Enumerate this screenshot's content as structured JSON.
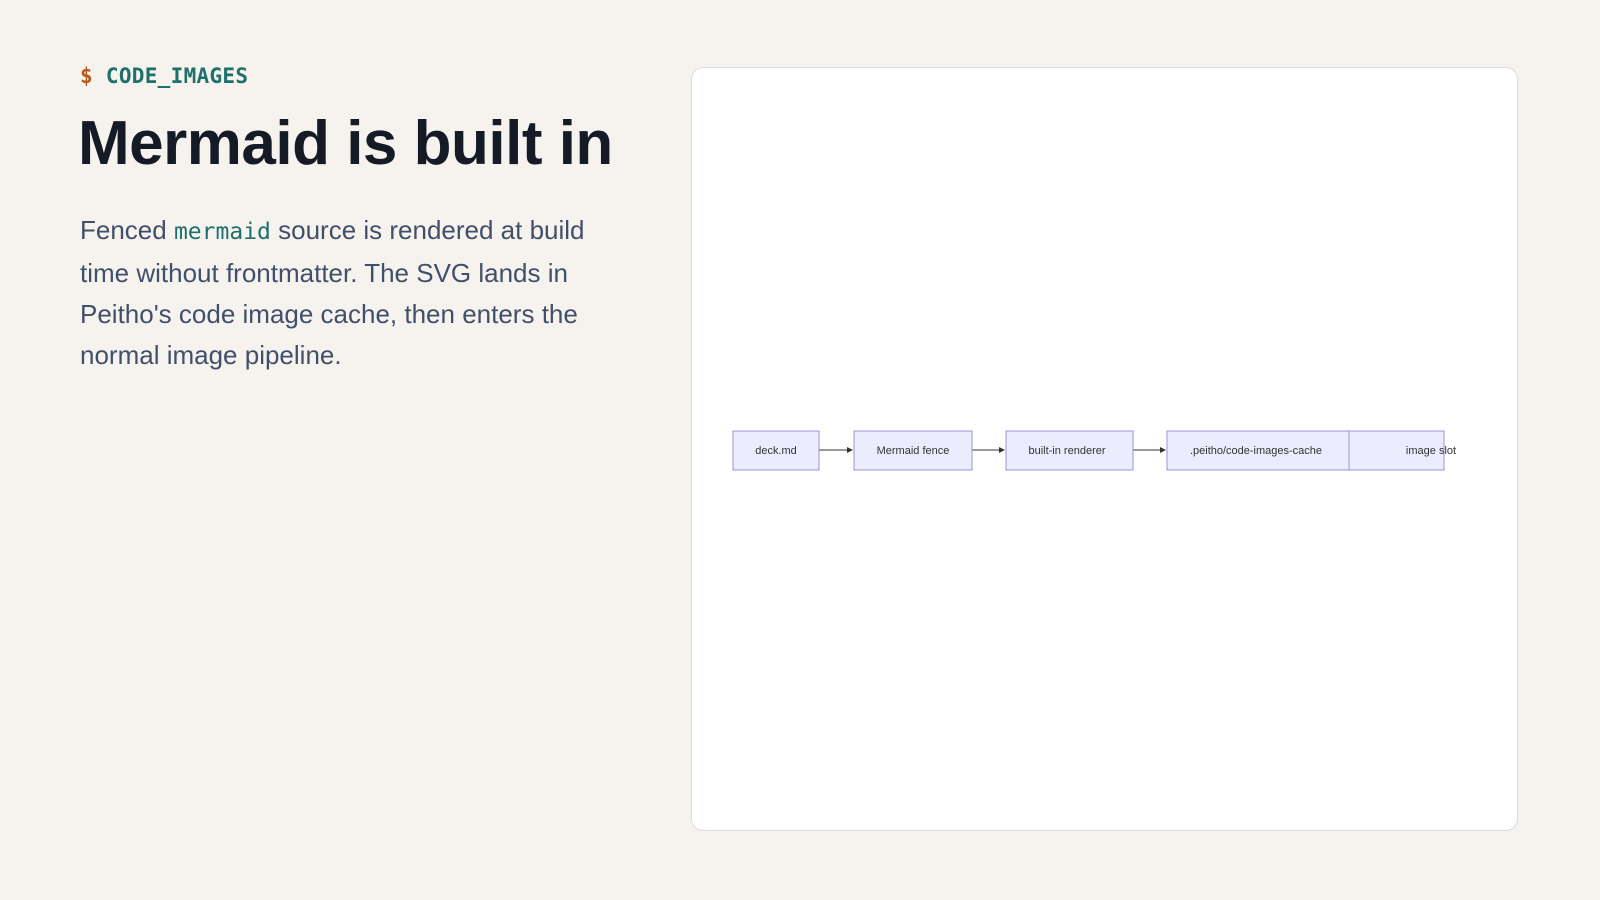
{
  "kicker": {
    "prompt": "$",
    "label": "CODE_IMAGES"
  },
  "title": "Mermaid is built in",
  "body": {
    "before": "Fenced ",
    "code": "mermaid",
    "after": " source is rendered at build time without frontmatter. The SVG lands in Peitho's code image cache, then enters the normal image pipeline."
  },
  "diagram": {
    "direction": "left-to-right",
    "nodes": [
      {
        "id": "n1",
        "label": "deck.md"
      },
      {
        "id": "n2",
        "label": "Mermaid fence"
      },
      {
        "id": "n3",
        "label": "built-in renderer"
      },
      {
        "id": "n4",
        "label": ".peitho/code-images-cache"
      },
      {
        "id": "n5",
        "label": "image slot"
      }
    ],
    "edges": [
      {
        "from": "n1",
        "to": "n2"
      },
      {
        "from": "n2",
        "to": "n3"
      },
      {
        "from": "n3",
        "to": "n4"
      },
      {
        "from": "n4",
        "to": "n5"
      }
    ],
    "colors": {
      "node_fill": "#ececff",
      "node_stroke": "#9c92d8",
      "edge": "#333333"
    }
  }
}
